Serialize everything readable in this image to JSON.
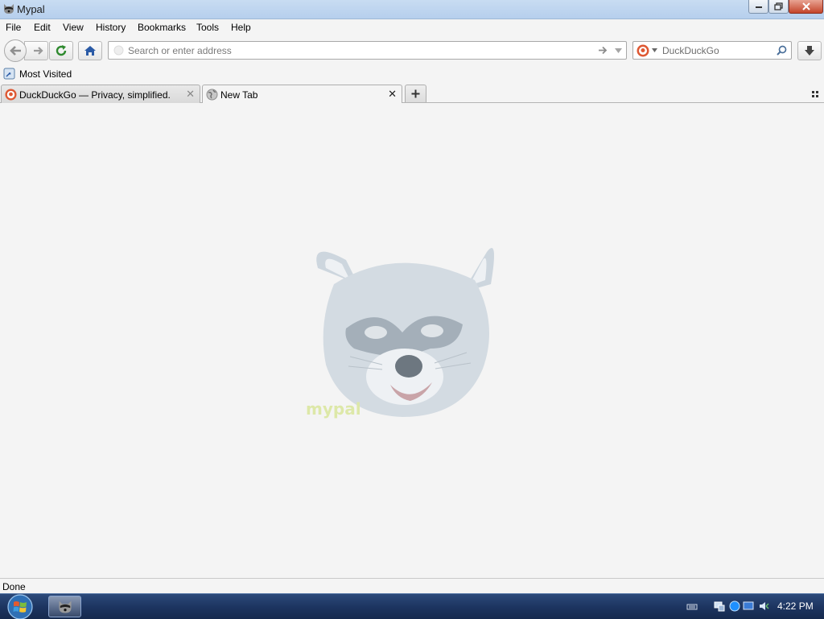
{
  "window": {
    "title": "Mypal"
  },
  "menu": {
    "items": [
      "File",
      "Edit",
      "View",
      "History",
      "Bookmarks",
      "Tools",
      "Help"
    ]
  },
  "navbar": {
    "url_placeholder": "Search or enter address",
    "search_placeholder": "DuckDuckGo"
  },
  "bookmarks": {
    "most_visited": "Most Visited"
  },
  "tabs": [
    {
      "label": "DuckDuckGo — Privacy, simplified.",
      "selected": false
    },
    {
      "label": "New Tab",
      "selected": true
    }
  ],
  "content": {
    "mascot_caption": "mypal"
  },
  "status": {
    "text": "Done"
  },
  "taskbar": {
    "clock": "4:22 PM"
  },
  "colors": {
    "titlebar": "#c8dcf2",
    "taskbar": "#1d3561",
    "close_button": "#c4442a",
    "content_bg": "#f4f4f4"
  },
  "icons": {
    "app": "raccoon-icon",
    "back": "back-arrow-icon",
    "forward": "forward-arrow-icon",
    "reload": "reload-icon",
    "home": "home-icon",
    "go": "go-arrow-icon",
    "dropdown": "dropdown-icon",
    "search_engine": "duckduckgo-icon",
    "search": "magnifier-icon",
    "download": "download-icon",
    "tab_grid": "tab-grid-icon",
    "start": "windows-start-icon"
  }
}
